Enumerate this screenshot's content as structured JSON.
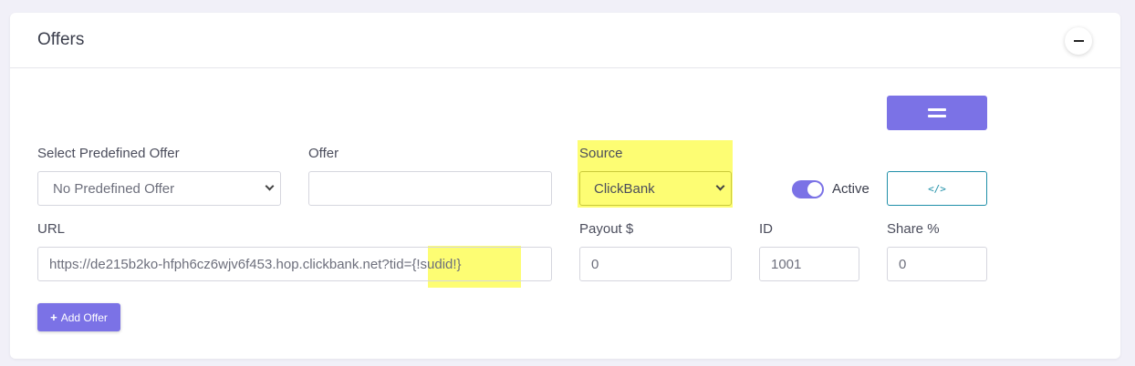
{
  "card": {
    "title": "Offers",
    "collapse_icon": "minus-icon"
  },
  "predefined": {
    "label": "Select Predefined Offer",
    "value": "No Predefined Offer"
  },
  "offer": {
    "label": "Offer",
    "value": ""
  },
  "source": {
    "label": "Source",
    "value": "ClickBank"
  },
  "active": {
    "label": "Active",
    "checked": true
  },
  "url": {
    "label": "URL",
    "value": "https://de215b2ko-hfph6cz6wjv6f453.hop.clickbank.net?tid={!sudid!}"
  },
  "payout": {
    "label": "Payout $",
    "value": "0"
  },
  "id": {
    "label": "ID",
    "value": "1001"
  },
  "share": {
    "label": "Share %",
    "value": "0"
  },
  "buttons": {
    "menu_icon": "equals-icon",
    "code_label": "</>",
    "add_offer": "Add Offer",
    "add_icon": "+"
  },
  "colors": {
    "accent": "#7b72e6",
    "teal": "#1f8fa8",
    "highlight": "#fdfd5a"
  }
}
